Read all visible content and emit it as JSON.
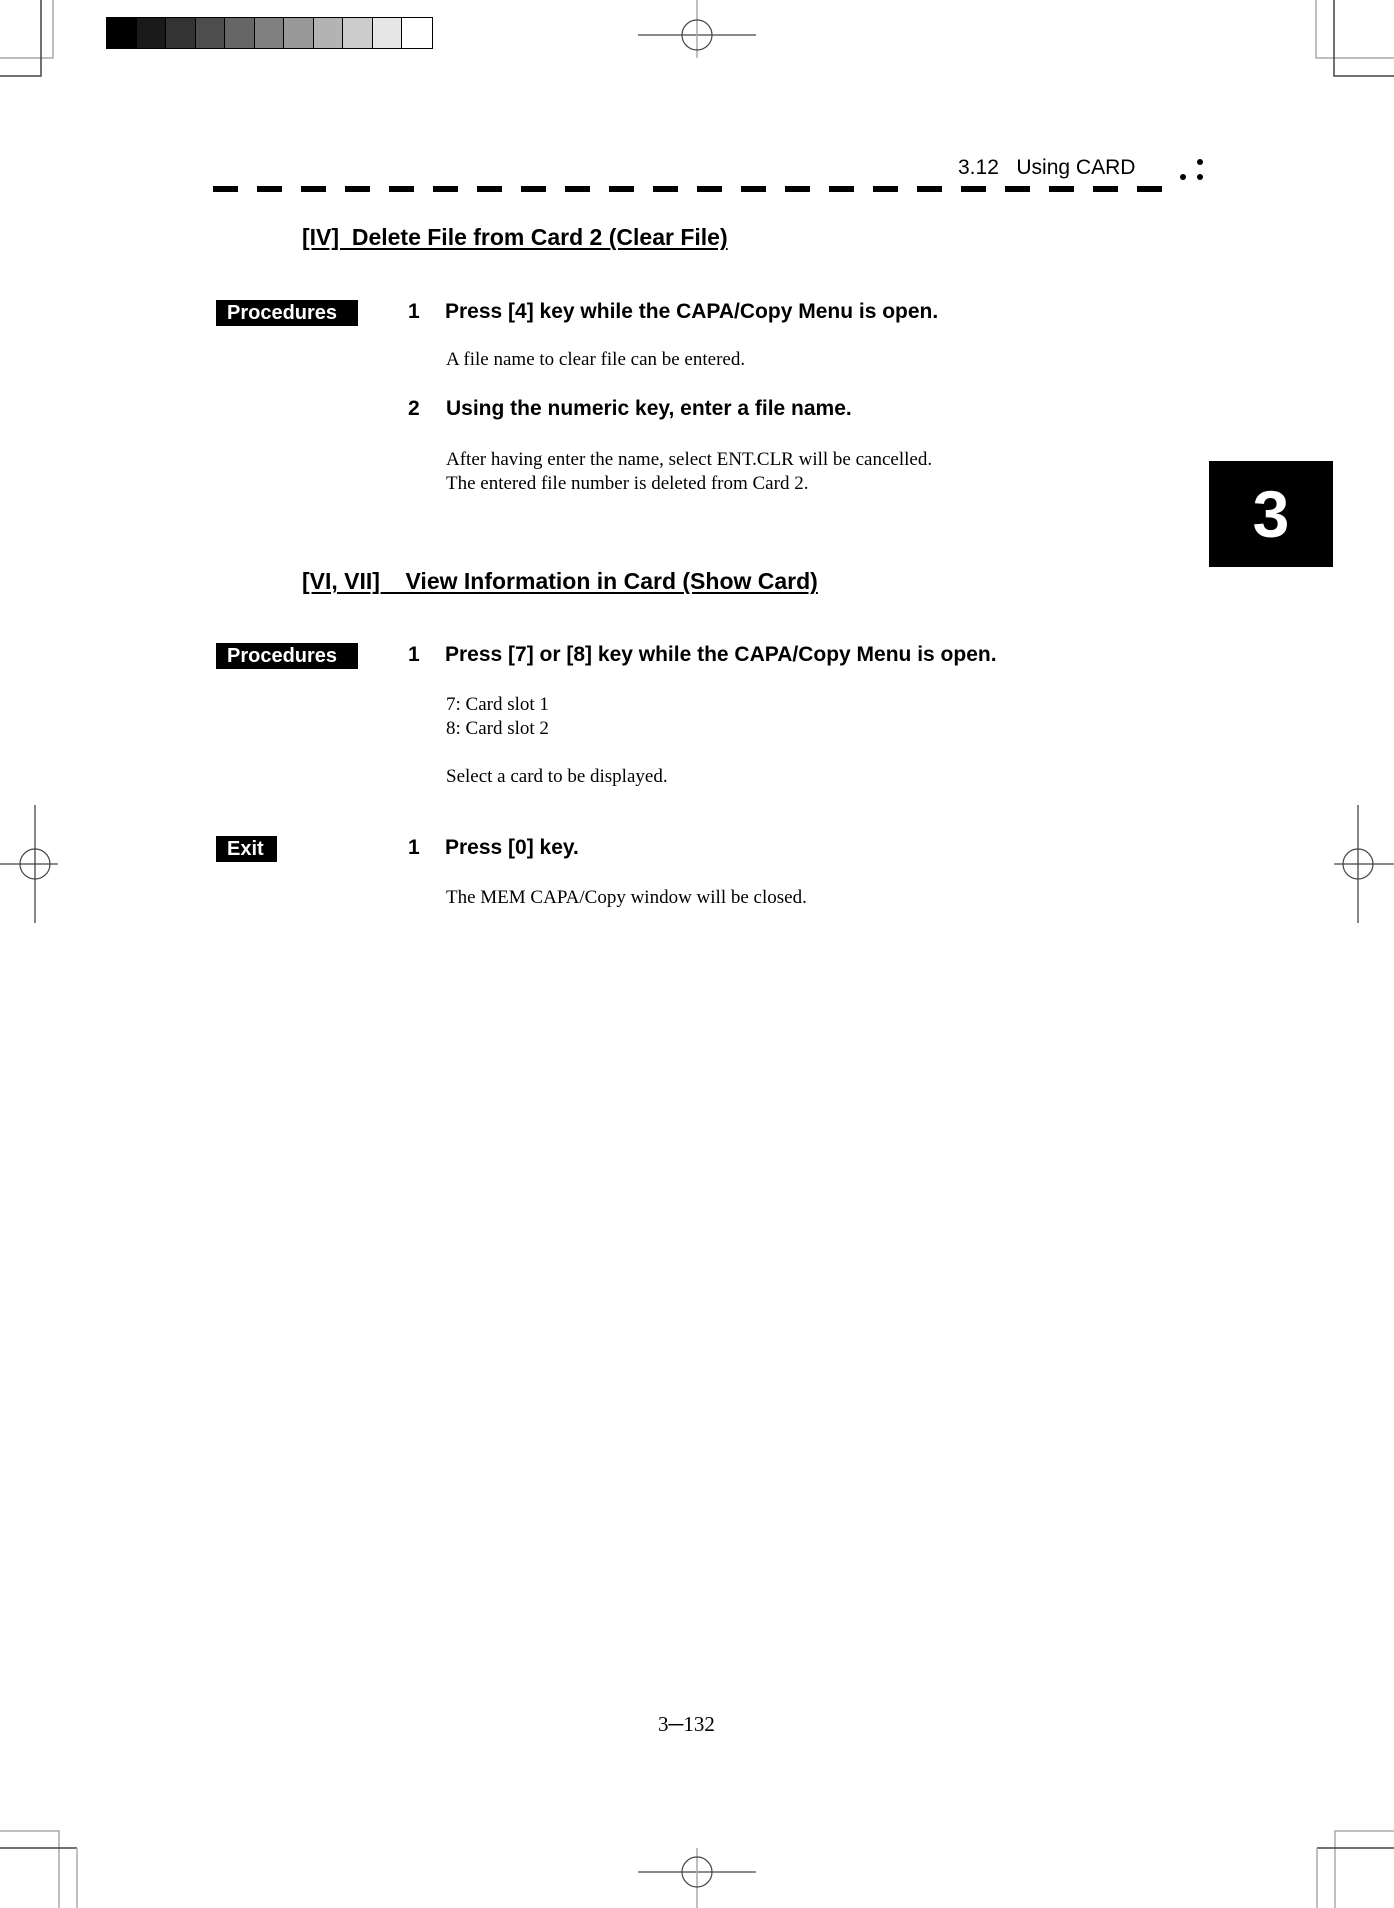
{
  "header": {
    "section": "3.12   Using CARD"
  },
  "chapter_tab": "3",
  "sections": [
    {
      "title": "[IV]  Delete File from Card 2 (Clear File)",
      "groups": [
        {
          "badge": "Procedures",
          "steps": [
            {
              "num": "1",
              "text": "Press [4] key while the CAPA/Copy Menu is open.",
              "desc": [
                "A file name to clear file can be entered."
              ]
            },
            {
              "num": "2",
              "text": "Using the numeric key, enter a file name.",
              "desc": [
                "After having enter the name, select ENT.CLR will be cancelled.",
                "The entered file number is deleted from Card 2."
              ]
            }
          ]
        }
      ]
    },
    {
      "title": "[VI, VII]    View Information in Card (Show Card)",
      "groups": [
        {
          "badge": "Procedures",
          "steps": [
            {
              "num": "1",
              "text": "Press [7] or [8] key while the CAPA/Copy Menu is open.",
              "desc": [
                "7: Card slot 1",
                "8: Card slot 2",
                "Select a card to be displayed."
              ]
            }
          ]
        },
        {
          "badge": "Exit",
          "steps": [
            {
              "num": "1",
              "text": "Press [0] key.",
              "desc": [
                "The MEM CAPA/Copy window will be closed."
              ]
            }
          ]
        }
      ]
    }
  ],
  "page_number": "3─132",
  "print_marks": {
    "color_bar_shades": [
      "#000000",
      "#1a1a1a",
      "#333333",
      "#4d4d4d",
      "#666666",
      "#808080",
      "#999999",
      "#b3b3b3",
      "#cccccc",
      "#e6e6e6",
      "#ffffff"
    ]
  }
}
